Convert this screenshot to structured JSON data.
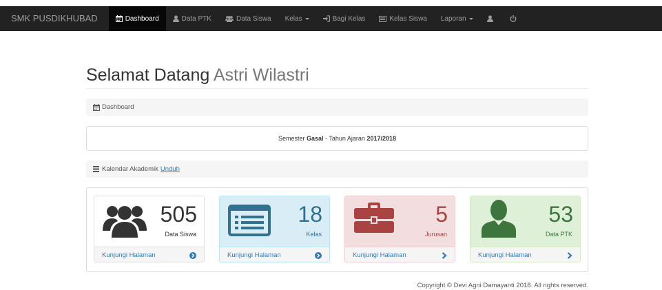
{
  "navbar": {
    "brand": "SMK PUSDIKHUBAD",
    "items": [
      {
        "label": "Dashboard",
        "icon": "calendar-icon",
        "active": true
      },
      {
        "label": "Data PTK",
        "icon": "user-icon"
      },
      {
        "label": "Data Siswa",
        "icon": "users-icon"
      },
      {
        "label": "Kelas",
        "icon": "",
        "dropdown": true
      },
      {
        "label": "Bagi Kelas",
        "icon": "sign-in-icon"
      },
      {
        "label": "Kelas Siswa",
        "icon": "list-alt-icon"
      },
      {
        "label": "Laporan",
        "icon": "",
        "dropdown": true
      }
    ],
    "icons": [
      "user-icon",
      "power-icon"
    ]
  },
  "page": {
    "title": "Selamat Datang",
    "user_name": "Astri Wilastri"
  },
  "breadcrumb": {
    "label": "Dashboard"
  },
  "semester": {
    "prefix": "Semester",
    "semester": "Gasal",
    "middle": "- Tahun Ajaran",
    "year": "2017/2018"
  },
  "kalendar": {
    "label": "Kalendar Akademik",
    "link": "Unduh"
  },
  "cards": [
    {
      "value": "505",
      "label": "Data Siswa",
      "link": "Kunjungi Halaman",
      "icon": "users-icon",
      "arrow": "circle-arrow-right-icon"
    },
    {
      "value": "18",
      "label": "Kelas",
      "link": "Kunjungi Halaman",
      "icon": "list-alt-icon",
      "arrow": "circle-arrow-right-icon"
    },
    {
      "value": "5",
      "label": "Jurusan",
      "link": "Kunjungi Halaman",
      "icon": "briefcase-icon",
      "arrow": "chevron-right-icon"
    },
    {
      "value": "53",
      "label": "Data PTK",
      "link": "Kunjungi Halaman",
      "icon": "user-icon",
      "arrow": "chevron-right-icon"
    }
  ],
  "footer": {
    "text": "Copyright © Devi Agni Damayanti 2018. All rights reserved."
  },
  "colors": {
    "navbar_bg": "#222222",
    "info_bg": "#d9edf7",
    "danger_bg": "#f2dede",
    "success_bg": "#dff0d8",
    "link": "#337ab7"
  }
}
